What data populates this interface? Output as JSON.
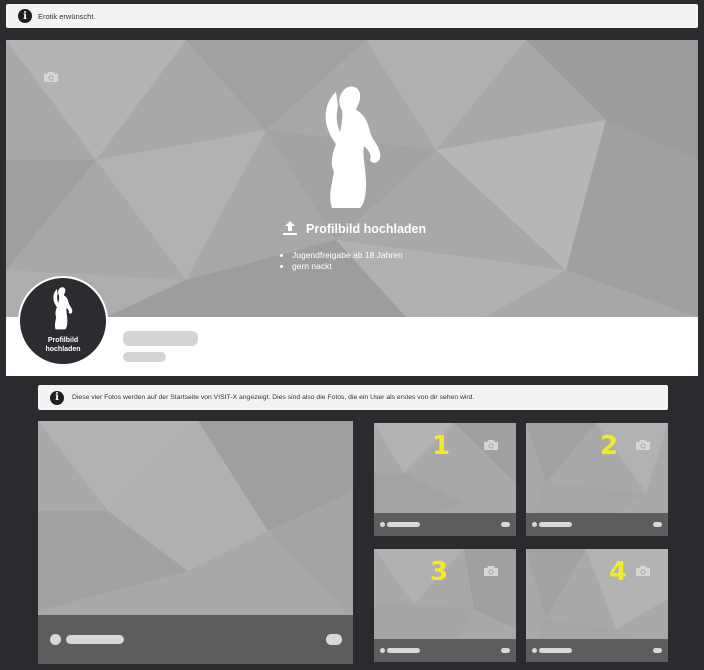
{
  "top_notice": {
    "icon": "info-icon",
    "text": "Erotik erwünscht."
  },
  "profile": {
    "cover_camera_icon": "camera-icon",
    "upload_label": "Profilbild hochladen",
    "rules": [
      "Jugendfreigabe ab 18 Jahren",
      "gern nackt"
    ],
    "avatar_label_line1": "Profilbild",
    "avatar_label_line2": "hochladen"
  },
  "photos_notice": {
    "icon": "info-icon",
    "text": "Diese vier Fotos werden auf der Startseite von VISIT-X angezeigt. Dies sind also die Fotos, die ein User als erstes von dir sehen wird."
  },
  "photo_slots": [
    {
      "number": "1"
    },
    {
      "number": "2"
    },
    {
      "number": "3"
    },
    {
      "number": "4"
    }
  ],
  "colors": {
    "accent_number": "#f2ea27",
    "tile": "#a9a9a9",
    "footer": "#5d5d5d"
  }
}
